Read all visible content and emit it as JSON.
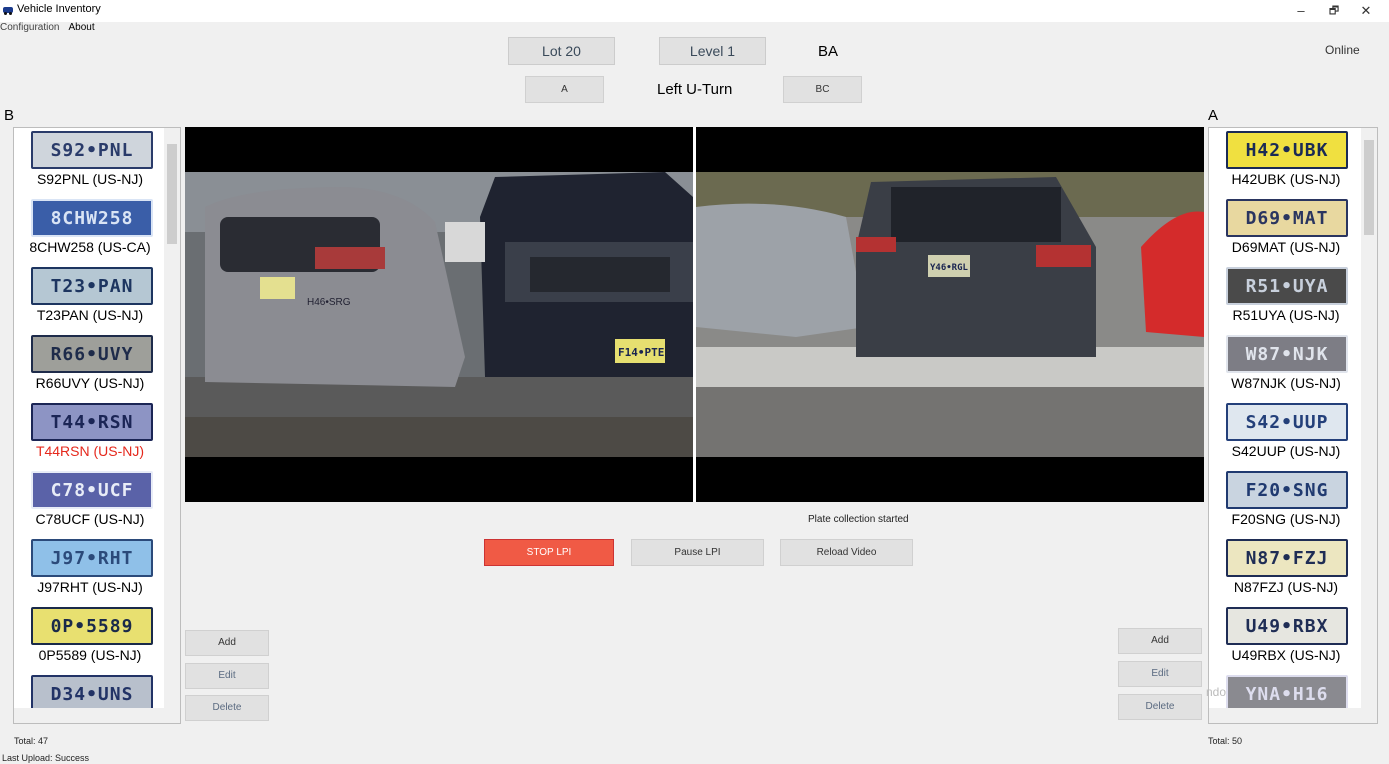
{
  "window": {
    "title": "Vehicle Inventory",
    "minimize": "–",
    "restore": "🗗",
    "close": "✕"
  },
  "menu": [
    "Configuration",
    "About"
  ],
  "header": {
    "lot": "Lot 20",
    "level": "Level 1",
    "zone": "BA",
    "status": "Online",
    "left_button": "A",
    "direction": "Left U-Turn",
    "right_button": "BC"
  },
  "left_panel": {
    "label": "B",
    "plates": [
      {
        "plate": "S92•PNL",
        "caption": "S92PNL (US-NJ)",
        "bg": "#cfd5dc",
        "fg": "#2a3b6a",
        "selected": false
      },
      {
        "plate": "8CHW258",
        "caption": "8CHW258 (US-CA)",
        "bg": "#3a5ea8",
        "fg": "#d9e4f5",
        "selected": false
      },
      {
        "plate": "T23•PAN",
        "caption": "T23PAN (US-NJ)",
        "bg": "#b5c7d3",
        "fg": "#1d3560",
        "selected": false
      },
      {
        "plate": "R66•UVY",
        "caption": "R66UVY (US-NJ)",
        "bg": "#9e9f9a",
        "fg": "#1e2b4a",
        "selected": false
      },
      {
        "plate": "T44•RSN",
        "caption": "T44RSN (US-NJ)",
        "bg": "#8d94c4",
        "fg": "#1b2555",
        "selected": true
      },
      {
        "plate": "C78•UCF",
        "caption": "C78UCF (US-NJ)",
        "bg": "#5a62a8",
        "fg": "#e8ecf7",
        "selected": false
      },
      {
        "plate": "J97•RHT",
        "caption": "J97RHT (US-NJ)",
        "bg": "#8fc0e8",
        "fg": "#2b4a7a",
        "selected": false
      },
      {
        "plate": "0P•5589",
        "caption": "0P5589 (US-NJ)",
        "bg": "#e8e070",
        "fg": "#1a2a4a",
        "selected": false
      },
      {
        "plate": "D34•UNS",
        "caption": "",
        "bg": "#b8c0cc",
        "fg": "#223366",
        "selected": false
      }
    ],
    "total": "Total: 47",
    "add": "Add",
    "edit": "Edit",
    "delete": "Delete"
  },
  "right_panel": {
    "label": "A",
    "plates": [
      {
        "plate": "H42•UBK",
        "caption": "H42UBK (US-NJ)",
        "bg": "#f0e040",
        "fg": "#1a2a55",
        "selected": false
      },
      {
        "plate": "D69•MAT",
        "caption": "D69MAT (US-NJ)",
        "bg": "#e8d8a0",
        "fg": "#2a3560",
        "selected": false
      },
      {
        "plate": "R51•UYA",
        "caption": "R51UYA (US-NJ)",
        "bg": "#4a4a4a",
        "fg": "#c8d0dc",
        "selected": false
      },
      {
        "plate": "W87•NJK",
        "caption": "W87NJK (US-NJ)",
        "bg": "#7d7d85",
        "fg": "#e0e4ec",
        "selected": false
      },
      {
        "plate": "S42•UUP",
        "caption": "S42UUP (US-NJ)",
        "bg": "#dfe7ef",
        "fg": "#24407a",
        "selected": false
      },
      {
        "plate": "F20•SNG",
        "caption": "F20SNG (US-NJ)",
        "bg": "#c9d4e0",
        "fg": "#203a70",
        "selected": false
      },
      {
        "plate": "N87•FZJ",
        "caption": "N87FZJ (US-NJ)",
        "bg": "#ece6c0",
        "fg": "#1f2d55",
        "selected": false
      },
      {
        "plate": "U49•RBX",
        "caption": "U49RBX (US-NJ)",
        "bg": "#e6e6e0",
        "fg": "#1f2d55",
        "selected": false
      },
      {
        "plate": "YNA•H16",
        "caption": "",
        "bg": "#8a8a90",
        "fg": "#dde",
        "selected": false
      }
    ],
    "total": "Total: 50",
    "add": "Add",
    "edit": "Edit",
    "delete": "Delete",
    "watermark": "ndo"
  },
  "video": {
    "left_plates": [
      "F14•PTE",
      "H46•SRG"
    ],
    "right_plate": "Y46•RGL"
  },
  "controls": {
    "status": "Plate collection started",
    "stop": "STOP LPI",
    "pause": "Pause LPI",
    "reload": "Reload Video"
  },
  "footer": {
    "upload": "Last Upload: Success"
  },
  "colors": {
    "stop_bg": "#f05a45",
    "selected_text": "#e5281c"
  }
}
